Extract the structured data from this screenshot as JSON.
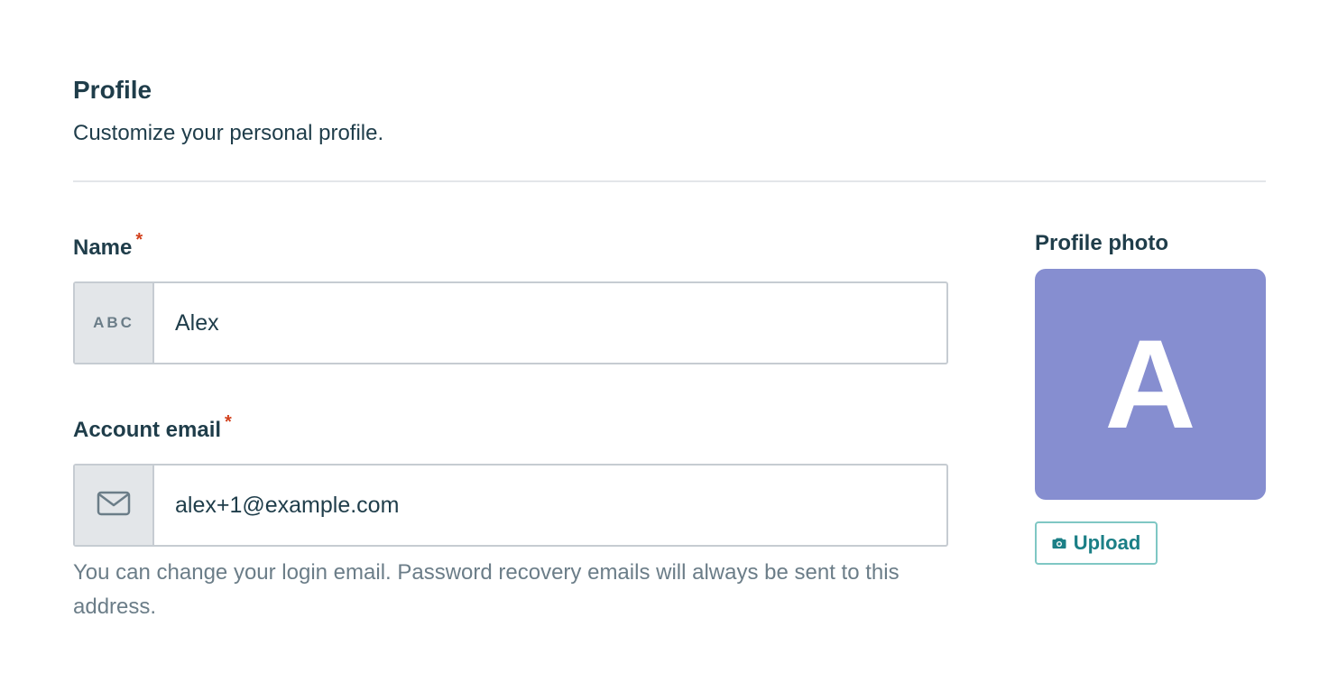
{
  "profile": {
    "title": "Profile",
    "subtitle": "Customize your personal profile."
  },
  "name_field": {
    "label": "Name",
    "required_marker": "*",
    "addon_text": "ABC",
    "value": "Alex"
  },
  "email_field": {
    "label": "Account email",
    "required_marker": "*",
    "addon_icon": "mail-icon",
    "value": "alex+1@example.com",
    "help_text": "You can change your login email. Password recovery emails will always be sent to this address."
  },
  "photo": {
    "label": "Profile photo",
    "avatar_initial": "A",
    "avatar_color": "#868ed0",
    "upload_label": "Upload",
    "upload_icon": "camera-icon"
  },
  "colors": {
    "text": "#1f3d4a",
    "muted": "#6b7d88",
    "required": "#d2411d",
    "accent": "#1b7f86"
  }
}
